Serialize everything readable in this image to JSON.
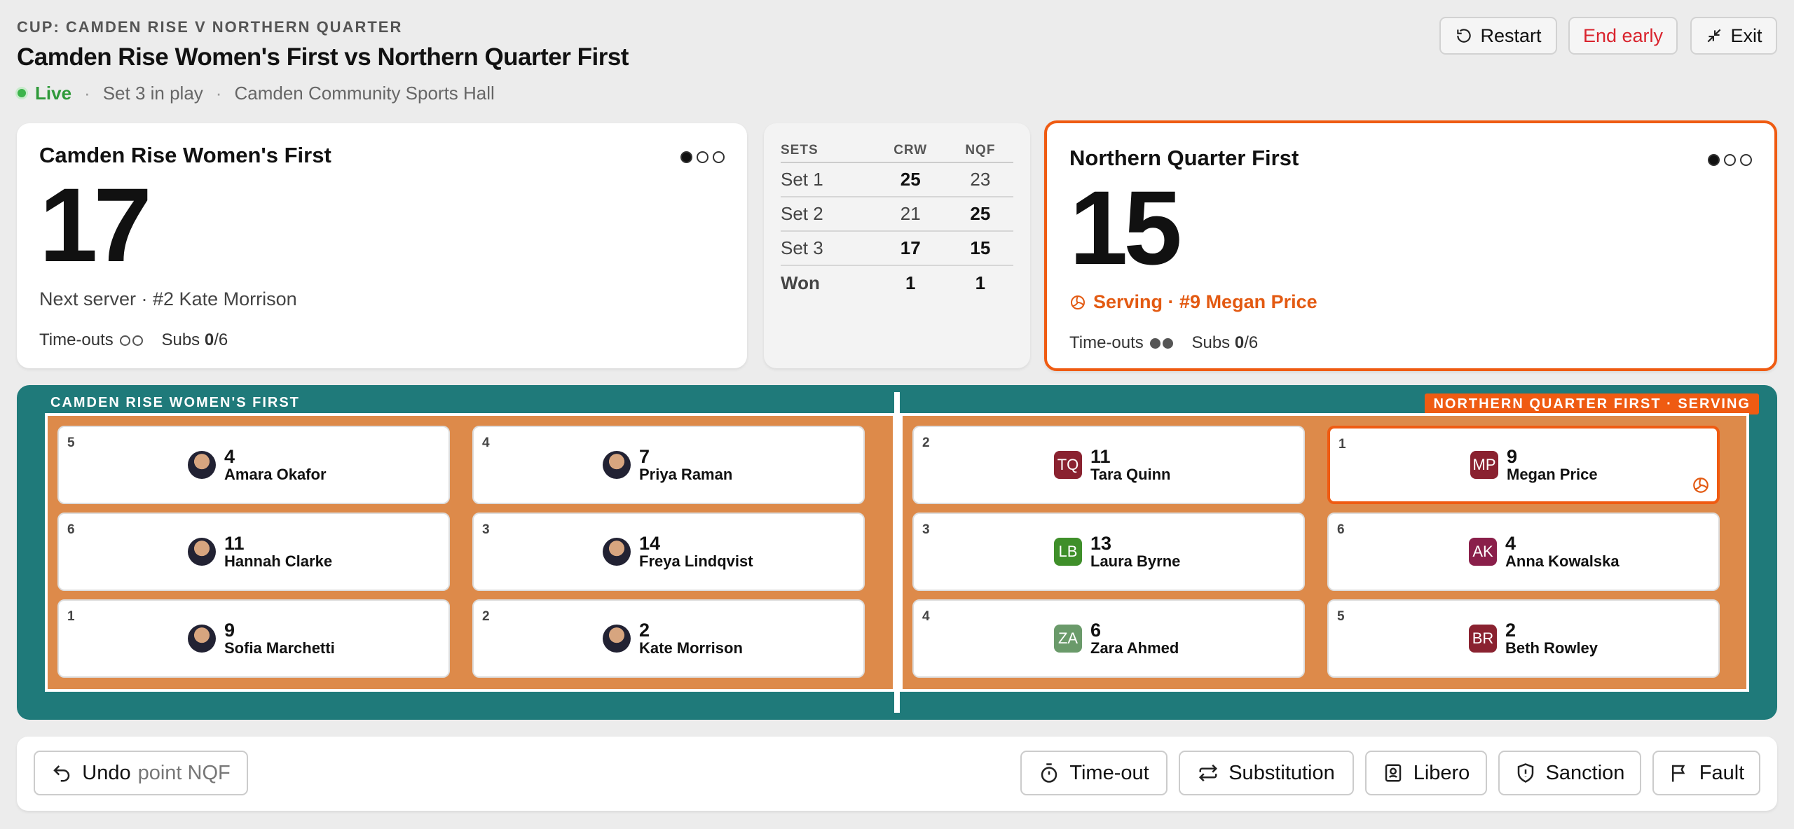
{
  "header": {
    "kicker": "CUP: CAMDEN RISE V NORTHERN QUARTER",
    "title": "Camden Rise Women's First vs Northern Quarter First",
    "live": "Live",
    "set_status": "Set 3 in play",
    "venue": "Camden Community Sports Hall"
  },
  "top_buttons": {
    "restart": "Restart",
    "end_early": "End early",
    "exit": "Exit"
  },
  "home": {
    "name": "Camden Rise Women's First",
    "score": "17",
    "status": "Next server · #2 Kate Morrison",
    "timeouts_label": "Time-outs",
    "timeouts_used": 0,
    "subs_label": "Subs",
    "subs_used": "0",
    "subs_total": "/6",
    "sets_dots": [
      true,
      false,
      false
    ]
  },
  "away": {
    "name": "Northern Quarter First",
    "score": "15",
    "status": "Serving · #9 Megan Price",
    "timeouts_label": "Time-outs",
    "timeouts_used": 2,
    "subs_label": "Subs",
    "subs_used": "0",
    "subs_total": "/6",
    "sets_dots": [
      true,
      false,
      false
    ]
  },
  "sets": {
    "headers": [
      "SETS",
      "CRW",
      "NQF"
    ],
    "rows": [
      {
        "label": "Set 1",
        "home": "25",
        "away": "23",
        "winner": "home"
      },
      {
        "label": "Set 2",
        "home": "21",
        "away": "25",
        "winner": "away"
      },
      {
        "label": "Set 3",
        "home": "17",
        "away": "15",
        "winner": "both"
      },
      {
        "label": "Won",
        "home": "1",
        "away": "1",
        "winner": "both"
      }
    ]
  },
  "court": {
    "home_label": "CAMDEN RISE WOMEN'S FIRST",
    "away_label": "NORTHERN QUARTER FIRST · SERVING",
    "home_players": [
      {
        "pos": "5",
        "num": "4",
        "name": "Amara Okafor"
      },
      {
        "pos": "4",
        "num": "7",
        "name": "Priya Raman"
      },
      {
        "pos": "6",
        "num": "11",
        "name": "Hannah Clarke"
      },
      {
        "pos": "3",
        "num": "14",
        "name": "Freya Lindqvist"
      },
      {
        "pos": "1",
        "num": "9",
        "name": "Sofia Marchetti"
      },
      {
        "pos": "2",
        "num": "2",
        "name": "Kate Morrison"
      }
    ],
    "away_players": [
      {
        "pos": "2",
        "num": "11",
        "name": "Tara Quinn",
        "initials": "TQ",
        "color": "#8a2230"
      },
      {
        "pos": "1",
        "num": "9",
        "name": "Megan Price",
        "initials": "MP",
        "color": "#8a2230",
        "serving": true
      },
      {
        "pos": "3",
        "num": "13",
        "name": "Laura Byrne",
        "initials": "LB",
        "color": "#3f8f2a"
      },
      {
        "pos": "6",
        "num": "4",
        "name": "Anna Kowalska",
        "initials": "AK",
        "color": "#8a1f4a"
      },
      {
        "pos": "4",
        "num": "6",
        "name": "Zara Ahmed",
        "initials": "ZA",
        "color": "#6a9a6a"
      },
      {
        "pos": "5",
        "num": "2",
        "name": "Beth Rowley",
        "initials": "BR",
        "color": "#8a2230"
      }
    ]
  },
  "bottom": {
    "undo": "Undo",
    "undo_detail": "point NQF",
    "timeout": "Time-out",
    "substitution": "Substitution",
    "libero": "Libero",
    "sanction": "Sanction",
    "fault": "Fault"
  },
  "colors": {
    "accent": "#ef5b12",
    "live": "#2f9a3a",
    "danger": "#d9232d",
    "court_bg": "#1f7a7a",
    "court": "#dd8a4a"
  }
}
